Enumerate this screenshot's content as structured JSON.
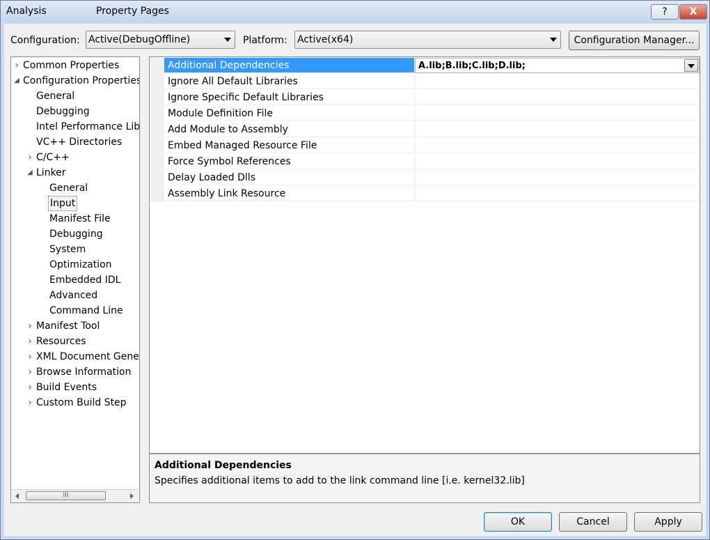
{
  "titlebar": {
    "app_name": "Analysis",
    "title": "Property Pages",
    "help_label": "?",
    "close_label": "X"
  },
  "toolbar": {
    "configuration_label": "Configuration:",
    "configuration_value": "Active(DebugOffline)",
    "platform_label": "Platform:",
    "platform_value": "Active(x64)",
    "config_manager_label": "Configuration Manager..."
  },
  "tree": {
    "items": [
      {
        "label": "Common Properties",
        "level": 0,
        "expander": "collapsed"
      },
      {
        "label": "Configuration Properties",
        "level": 0,
        "expander": "expanded"
      },
      {
        "label": "General",
        "level": 1,
        "expander": "none"
      },
      {
        "label": "Debugging",
        "level": 1,
        "expander": "none"
      },
      {
        "label": "Intel Performance Libraries",
        "level": 1,
        "expander": "none"
      },
      {
        "label": "VC++ Directories",
        "level": 1,
        "expander": "none"
      },
      {
        "label": "C/C++",
        "level": 1,
        "expander": "collapsed"
      },
      {
        "label": "Linker",
        "level": 1,
        "expander": "expanded"
      },
      {
        "label": "General",
        "level": 2,
        "expander": "none"
      },
      {
        "label": "Input",
        "level": 2,
        "expander": "none",
        "selected": true
      },
      {
        "label": "Manifest File",
        "level": 2,
        "expander": "none"
      },
      {
        "label": "Debugging",
        "level": 2,
        "expander": "none"
      },
      {
        "label": "System",
        "level": 2,
        "expander": "none"
      },
      {
        "label": "Optimization",
        "level": 2,
        "expander": "none"
      },
      {
        "label": "Embedded IDL",
        "level": 2,
        "expander": "none"
      },
      {
        "label": "Advanced",
        "level": 2,
        "expander": "none"
      },
      {
        "label": "Command Line",
        "level": 2,
        "expander": "none"
      },
      {
        "label": "Manifest Tool",
        "level": 1,
        "expander": "collapsed"
      },
      {
        "label": "Resources",
        "level": 1,
        "expander": "collapsed"
      },
      {
        "label": "XML Document Generator",
        "level": 1,
        "expander": "collapsed"
      },
      {
        "label": "Browse Information",
        "level": 1,
        "expander": "collapsed"
      },
      {
        "label": "Build Events",
        "level": 1,
        "expander": "collapsed"
      },
      {
        "label": "Custom Build Step",
        "level": 1,
        "expander": "collapsed"
      }
    ],
    "scroll_grip": "III"
  },
  "properties": {
    "rows": [
      {
        "name": "Additional Dependencies",
        "value": "A.lib;B.lib;C.lib;D.lib;",
        "selected": true
      },
      {
        "name": "Ignore All Default Libraries",
        "value": ""
      },
      {
        "name": "Ignore Specific Default Libraries",
        "value": ""
      },
      {
        "name": "Module Definition File",
        "value": ""
      },
      {
        "name": "Add Module to Assembly",
        "value": ""
      },
      {
        "name": "Embed Managed Resource File",
        "value": ""
      },
      {
        "name": "Force Symbol References",
        "value": ""
      },
      {
        "name": "Delay Loaded Dlls",
        "value": ""
      },
      {
        "name": "Assembly Link Resource",
        "value": ""
      }
    ]
  },
  "description": {
    "title": "Additional Dependencies",
    "text": "Specifies additional items to add to the link command line [i.e. kernel32.lib]"
  },
  "buttons": {
    "ok": "OK",
    "cancel": "Cancel",
    "apply": "Apply"
  }
}
